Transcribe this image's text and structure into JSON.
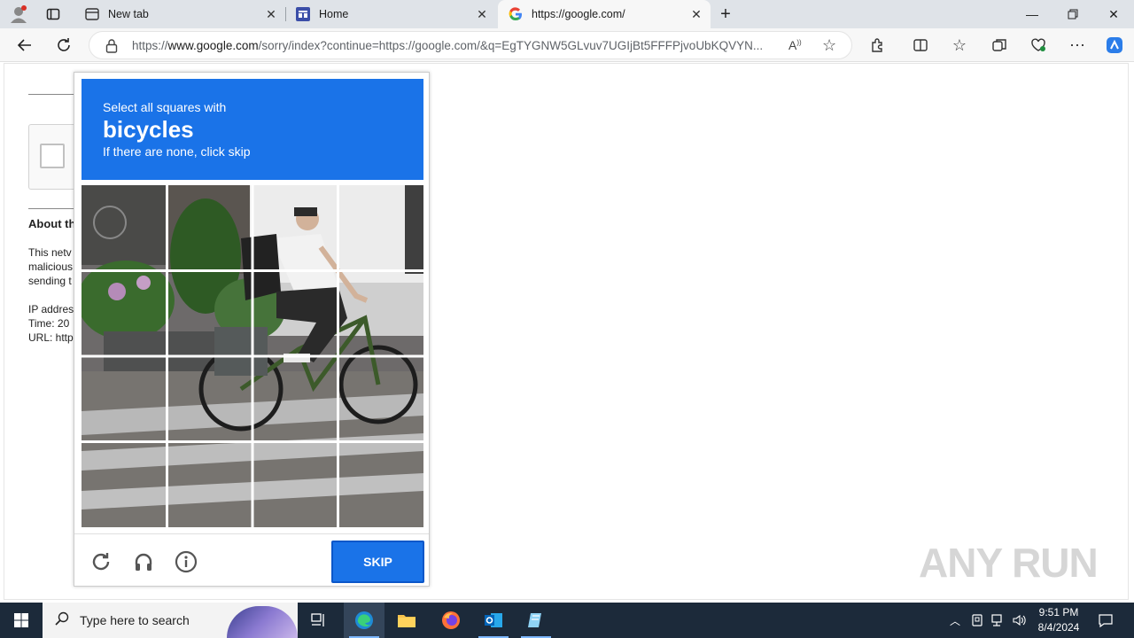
{
  "browser": {
    "tabs": [
      {
        "label": "New tab",
        "icon": "newtab-icon"
      },
      {
        "label": "Home",
        "icon": "home-site-icon"
      },
      {
        "label": "https://google.com/",
        "icon": "google-icon",
        "active": true
      }
    ],
    "address": {
      "url_prefix": "https://",
      "url_domain": "www.google.com",
      "url_rest": "/sorry/index?continue=https://google.com/&q=EgTYGNW5GLvuv7UGIjBt5FFFPjvoUbKQVYN..."
    }
  },
  "background_page": {
    "about_heading": "About th",
    "lines": [
      "This netv",
      "malicious",
      "sending t",
      "",
      "IP addres",
      "Time: 20",
      "URL: http"
    ]
  },
  "captcha": {
    "line1": "Select all squares with",
    "target": "bicycles",
    "line3": "If there are none, click skip",
    "skip_label": "SKIP"
  },
  "watermark": "ANY RUN",
  "taskbar": {
    "search_placeholder": "Type here to search",
    "time": "9:51 PM",
    "date": "8/4/2024"
  },
  "colors": {
    "captcha_blue": "#1a73e8",
    "taskbar": "#1c2a3a"
  }
}
